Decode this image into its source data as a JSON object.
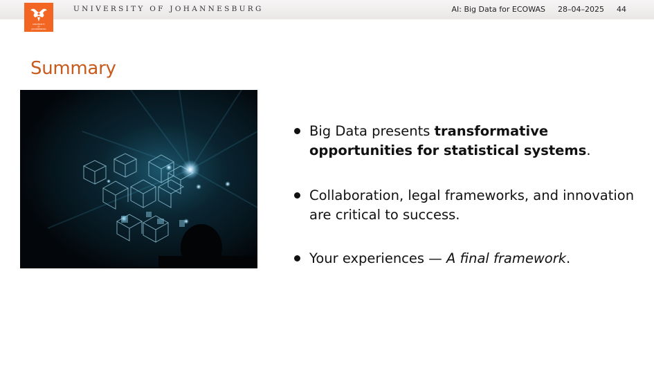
{
  "header": {
    "university": "UNIVERSITY OF JOHANNESBURG",
    "presentation_title": "AI: Big Data for ECOWAS",
    "date": "28–04–2025",
    "page_number": "44"
  },
  "logo": {
    "text_line1": "UNIVERSITY",
    "text_line2": "OF",
    "text_line3": "JOHANNESBURG",
    "color": "#f26522"
  },
  "slide": {
    "title": "Summary",
    "title_color": "#c85a1c"
  },
  "photo": {
    "description_icon": "concert-light-installation-image"
  },
  "bullets": [
    {
      "pre": "Big Data presents ",
      "bold": "transformative opportunities for statistical systems",
      "post": "."
    },
    {
      "text": "Collaboration, legal frameworks, and innovation are critical to success."
    },
    {
      "pre": "Your experiences — ",
      "italic": "A final framework",
      "post": "."
    }
  ]
}
